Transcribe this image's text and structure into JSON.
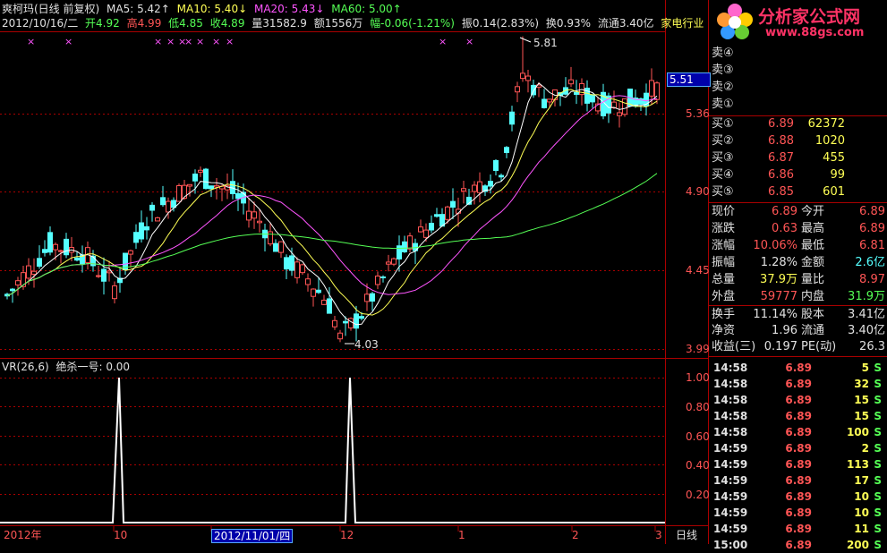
{
  "header": {
    "stock_name": "爽柯玛(日线 前复权)",
    "ma5": "MA5: 5.42↑",
    "ma10": "MA10: 5.40↓",
    "ma20": "MA20: 5.43↓",
    "ma60": "MA60: 5.00↑",
    "line2_date": "2012/10/16/二",
    "open": "开4.92",
    "high": "高4.99",
    "low": "低4.85",
    "close": "收4.89",
    "volume": "量31582.9",
    "amount": "额1556万",
    "change": "幅-0.06(-1.21%)",
    "amplitude": "振0.14(2.83%)",
    "turnover": "换0.93%",
    "float": "流通3.40亿",
    "industry": "家电行业"
  },
  "price_axis": [
    "5.51",
    "5.36",
    "4.90",
    "4.45",
    "3.99"
  ],
  "annotations": {
    "high_mark": "5.81",
    "low_mark": "4.03"
  },
  "indicator": {
    "title": "VR(26,6)",
    "signal": "绝杀一号: 0.00",
    "axis": [
      "1.00",
      "0.80",
      "0.60",
      "0.40",
      "0.20"
    ]
  },
  "time_axis": [
    "2012年",
    "10",
    "2012/11/01/四",
    "12",
    "1",
    "2",
    "3"
  ],
  "period_label": "日线",
  "logo": {
    "text": "分析家公式网",
    "url": "www.88gs.com"
  },
  "sell_orders": [
    {
      "label": "卖④"
    },
    {
      "label": "卖③"
    },
    {
      "label": "卖②"
    },
    {
      "label": "卖①"
    }
  ],
  "buy_orders": [
    {
      "label": "买①",
      "price": "6.89",
      "volume": "62372"
    },
    {
      "label": "买②",
      "price": "6.88",
      "volume": "1020"
    },
    {
      "label": "买③",
      "price": "6.87",
      "volume": "455"
    },
    {
      "label": "买④",
      "price": "6.86",
      "volume": "99"
    },
    {
      "label": "买⑤",
      "price": "6.85",
      "volume": "601"
    }
  ],
  "quote": [
    {
      "l1": "现价",
      "v1": "6.89",
      "l2": "今开",
      "v2": "6.89"
    },
    {
      "l1": "涨跌",
      "v1": "0.63",
      "l2": "最高",
      "v2": "6.89"
    },
    {
      "l1": "涨幅",
      "v1": "10.06%",
      "l2": "最低",
      "v2": "6.81"
    },
    {
      "l1": "振幅",
      "v1": "1.28%",
      "l2": "金额",
      "v2": "2.6亿"
    },
    {
      "l1": "总量",
      "v1": "37.9万",
      "l2": "量比",
      "v2": "8.97"
    },
    {
      "l1": "外盘",
      "v1": "59777",
      "l2": "内盘",
      "v2": "31.9万"
    }
  ],
  "info": [
    {
      "l1": "换手",
      "v1": "11.14%",
      "l2": "股本",
      "v2": "3.41亿"
    },
    {
      "l1": "净资",
      "v1": "1.96",
      "l2": "流通",
      "v2": "3.40亿"
    },
    {
      "l1": "收益(三)",
      "v1": "0.197",
      "l2": "PE(动)",
      "v2": "26.3"
    }
  ],
  "ticks": [
    {
      "time": "14:58",
      "price": "6.89",
      "vol": "5",
      "side": "S"
    },
    {
      "time": "14:58",
      "price": "6.89",
      "vol": "32",
      "side": "S"
    },
    {
      "time": "14:58",
      "price": "6.89",
      "vol": "15",
      "side": "S"
    },
    {
      "time": "14:58",
      "price": "6.89",
      "vol": "15",
      "side": "S"
    },
    {
      "time": "14:58",
      "price": "6.89",
      "vol": "100",
      "side": "S"
    },
    {
      "time": "14:59",
      "price": "6.89",
      "vol": "2",
      "side": "S"
    },
    {
      "time": "14:59",
      "price": "6.89",
      "vol": "113",
      "side": "S"
    },
    {
      "time": "14:59",
      "price": "6.89",
      "vol": "17",
      "side": "S"
    },
    {
      "time": "14:59",
      "price": "6.89",
      "vol": "10",
      "side": "S"
    },
    {
      "time": "14:59",
      "price": "6.89",
      "vol": "10",
      "side": "S"
    },
    {
      "time": "14:59",
      "price": "6.89",
      "vol": "11",
      "side": "S"
    },
    {
      "time": "15:00",
      "price": "6.89",
      "vol": "200",
      "side": "S"
    }
  ],
  "colors": {
    "up": "#ff5555",
    "down": "#55ffff",
    "ma5": "#ffffff",
    "ma10": "#ffff55",
    "ma20": "#ff55ff",
    "ma60": "#55ff55"
  }
}
